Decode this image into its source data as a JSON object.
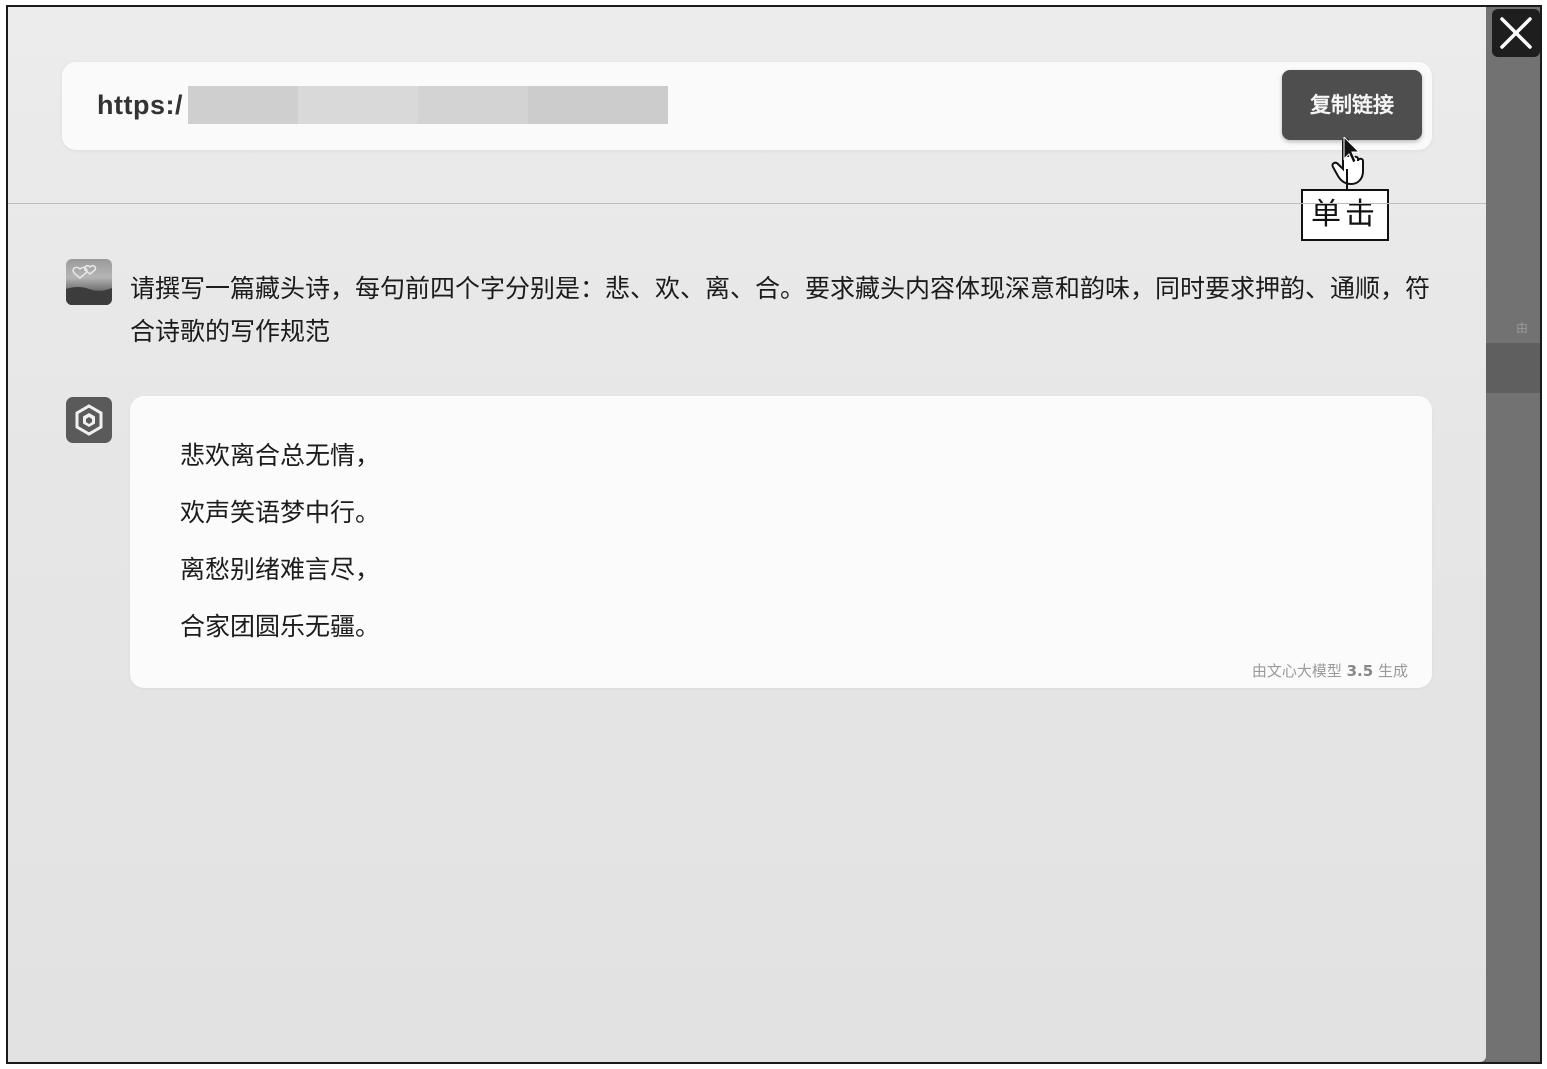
{
  "url_bar": {
    "url_prefix": "https:/",
    "copy_button_label": "复制链接"
  },
  "annotation": {
    "callout_label": "单击"
  },
  "close": {
    "icon": "close-icon"
  },
  "conversation": {
    "user_message": "请撰写一篇藏头诗，每句前四个字分别是：悲、欢、离、合。要求藏头内容体现深意和韵味，同时要求押韵、通顺，符合诗歌的写作规范",
    "bot_poem_lines": [
      "悲欢离合总无情，",
      "欢声笑语梦中行。",
      "离愁别绪难言尽，",
      "合家团圆乐无疆。"
    ],
    "model_tag": {
      "prefix": "由文心大模型",
      "version": "3.5",
      "suffix": "生成"
    }
  },
  "side_peek_text": "由",
  "colors": {
    "copy_button_bg": "#4e4e4e",
    "overlay": "#6e6e6e",
    "close_button_bg": "#1e1e1e"
  }
}
